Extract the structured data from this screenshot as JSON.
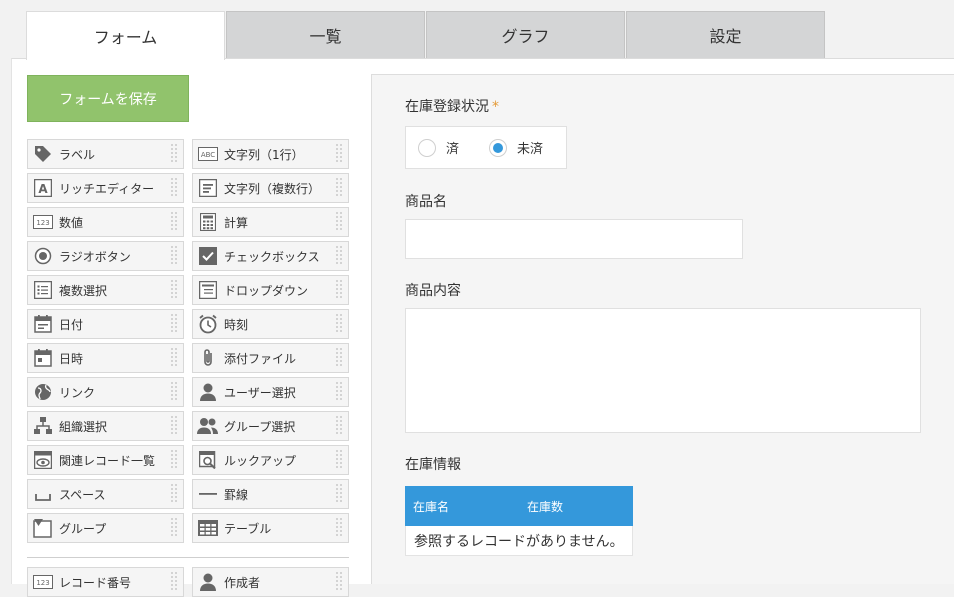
{
  "tabs": [
    {
      "label": "フォーム",
      "active": true
    },
    {
      "label": "一覧",
      "active": false
    },
    {
      "label": "グラフ",
      "active": false
    },
    {
      "label": "設定",
      "active": false
    }
  ],
  "toolbar": {
    "save_label": "フォームを保存"
  },
  "palette": [
    {
      "label": "ラベル",
      "icon": "tag-icon"
    },
    {
      "label": "文字列（1行）",
      "icon": "abc-text-icon"
    },
    {
      "label": "リッチエディター",
      "icon": "rich-editor-icon"
    },
    {
      "label": "文字列（複数行）",
      "icon": "multiline-text-icon"
    },
    {
      "label": "数値",
      "icon": "number-icon"
    },
    {
      "label": "計算",
      "icon": "calculator-icon"
    },
    {
      "label": "ラジオボタン",
      "icon": "radio-icon"
    },
    {
      "label": "チェックボックス",
      "icon": "checkbox-icon"
    },
    {
      "label": "複数選択",
      "icon": "multi-select-icon"
    },
    {
      "label": "ドロップダウン",
      "icon": "dropdown-icon"
    },
    {
      "label": "日付",
      "icon": "date-icon"
    },
    {
      "label": "時刻",
      "icon": "clock-icon"
    },
    {
      "label": "日時",
      "icon": "datetime-icon"
    },
    {
      "label": "添付ファイル",
      "icon": "paperclip-icon"
    },
    {
      "label": "リンク",
      "icon": "globe-icon"
    },
    {
      "label": "ユーザー選択",
      "icon": "user-icon"
    },
    {
      "label": "組織選択",
      "icon": "org-chart-icon"
    },
    {
      "label": "グループ選択",
      "icon": "group-icon"
    },
    {
      "label": "関連レコード一覧",
      "icon": "related-records-icon"
    },
    {
      "label": "ルックアップ",
      "icon": "lookup-icon"
    },
    {
      "label": "スペース",
      "icon": "space-icon"
    },
    {
      "label": "罫線",
      "icon": "line-icon"
    },
    {
      "label": "グループ",
      "icon": "group-field-icon"
    },
    {
      "label": "テーブル",
      "icon": "table-icon"
    },
    {
      "label": "レコード番号",
      "icon": "record-number-icon"
    },
    {
      "label": "作成者",
      "icon": "creator-icon"
    }
  ],
  "form": {
    "status_label": "在庫登録状況",
    "required_mark": "*",
    "radio_options": [
      {
        "label": "済",
        "selected": false
      },
      {
        "label": "未済",
        "selected": true
      }
    ],
    "product_name_label": "商品名",
    "product_name_value": "",
    "product_desc_label": "商品内容",
    "product_desc_value": "",
    "stock_info_label": "在庫情報",
    "stock_table": {
      "columns": [
        "在庫名",
        "在庫数"
      ],
      "empty_message": "参照するレコードがありません。"
    }
  },
  "colors": {
    "accent": "#3498db",
    "save_button": "#91c36c",
    "required": "#e49a36"
  }
}
